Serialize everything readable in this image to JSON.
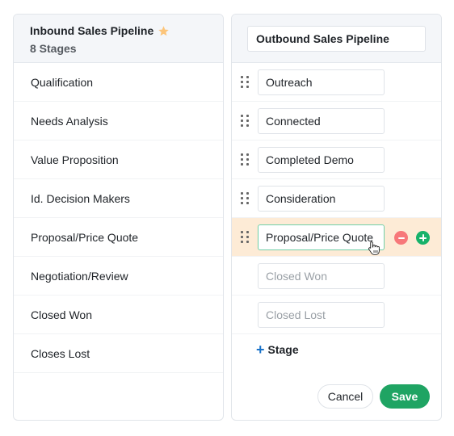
{
  "inbound": {
    "title": "Inbound Sales Pipeline",
    "favorite_icon": "star-icon",
    "favorite_color": "#fcc57a",
    "stage_count": "8 Stages",
    "stages": [
      "Qualification",
      "Needs Analysis",
      "Value Proposition",
      "Id. Decision Makers",
      "Proposal/Price Quote",
      "Negotiation/Review",
      "Closed Won",
      "Closes Lost"
    ]
  },
  "outbound": {
    "name_value": "Outbound Sales Pipeline",
    "stages": [
      {
        "value": "Outreach",
        "placeholder": ""
      },
      {
        "value": "Connected",
        "placeholder": ""
      },
      {
        "value": "Completed Demo",
        "placeholder": ""
      },
      {
        "value": "Consideration",
        "placeholder": ""
      },
      {
        "value": "Proposal/Price Quote",
        "placeholder": "",
        "active": true
      },
      {
        "value": "",
        "placeholder": "Closed Won"
      },
      {
        "value": "",
        "placeholder": "Closed Lost"
      }
    ],
    "add_stage_label": "Stage",
    "add_stage_icon": "plus-icon",
    "cancel_label": "Cancel",
    "save_label": "Save",
    "colors": {
      "highlight_row": "#fdebd6",
      "remove": "#f7787a",
      "add": "#17b26a",
      "save": "#1fa463",
      "add_stage_plus": "#1a73c9",
      "active_border": "#6fcfa8"
    }
  }
}
